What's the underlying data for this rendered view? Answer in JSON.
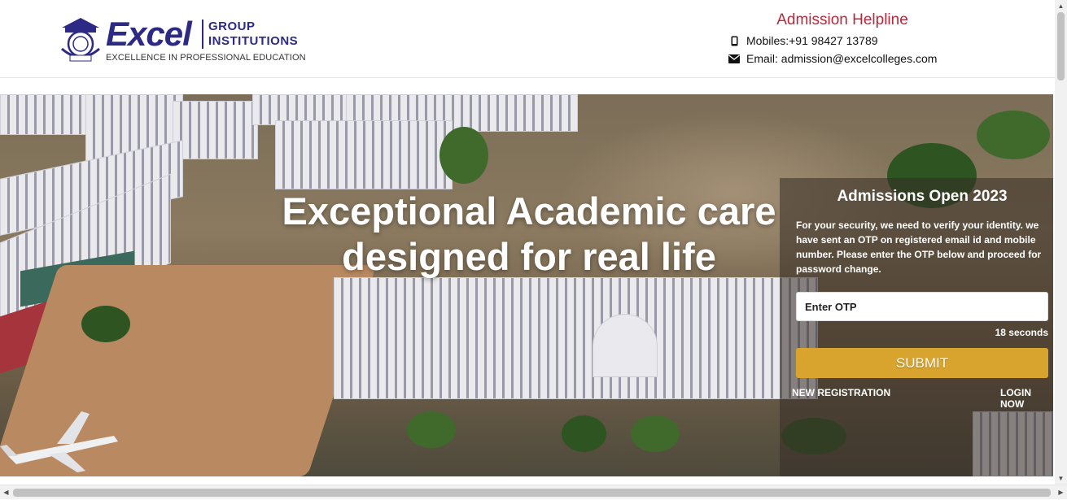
{
  "header": {
    "logo": {
      "seal_text_top": "SRET",
      "seal_text_bottom": "EXCEL",
      "brand": "Excel",
      "group_line1": "GROUP",
      "group_line2": "INSTITUTIONS",
      "tagline": "EXCELLENCE IN PROFESSIONAL EDUCATION"
    },
    "helpline": {
      "title": "Admission Helpline",
      "mobile": "Mobiles:+91 98427 13789",
      "email": "Email: admission@excelcolleges.com",
      "mobile_icon": "mobile-phone-icon",
      "email_icon": "envelope-icon"
    }
  },
  "hero": {
    "headline": "Exceptional Academic care designed for real life"
  },
  "panel": {
    "title": "Admissions Open 2023",
    "message": "For your security, we need to verify your identity. we have sent an OTP on registered email id and mobile number. Please enter the OTP below and proceed for password change.",
    "otp_placeholder": "Enter OTP",
    "timer": "18 seconds",
    "submit_label": "SUBMIT",
    "new_registration": "NEW REGISTRATION",
    "login_now": "LOGIN NOW"
  },
  "colors": {
    "brand_navy": "#2d2a86",
    "helpline_red": "#b8283b",
    "submit_gold": "#d9a42e"
  }
}
